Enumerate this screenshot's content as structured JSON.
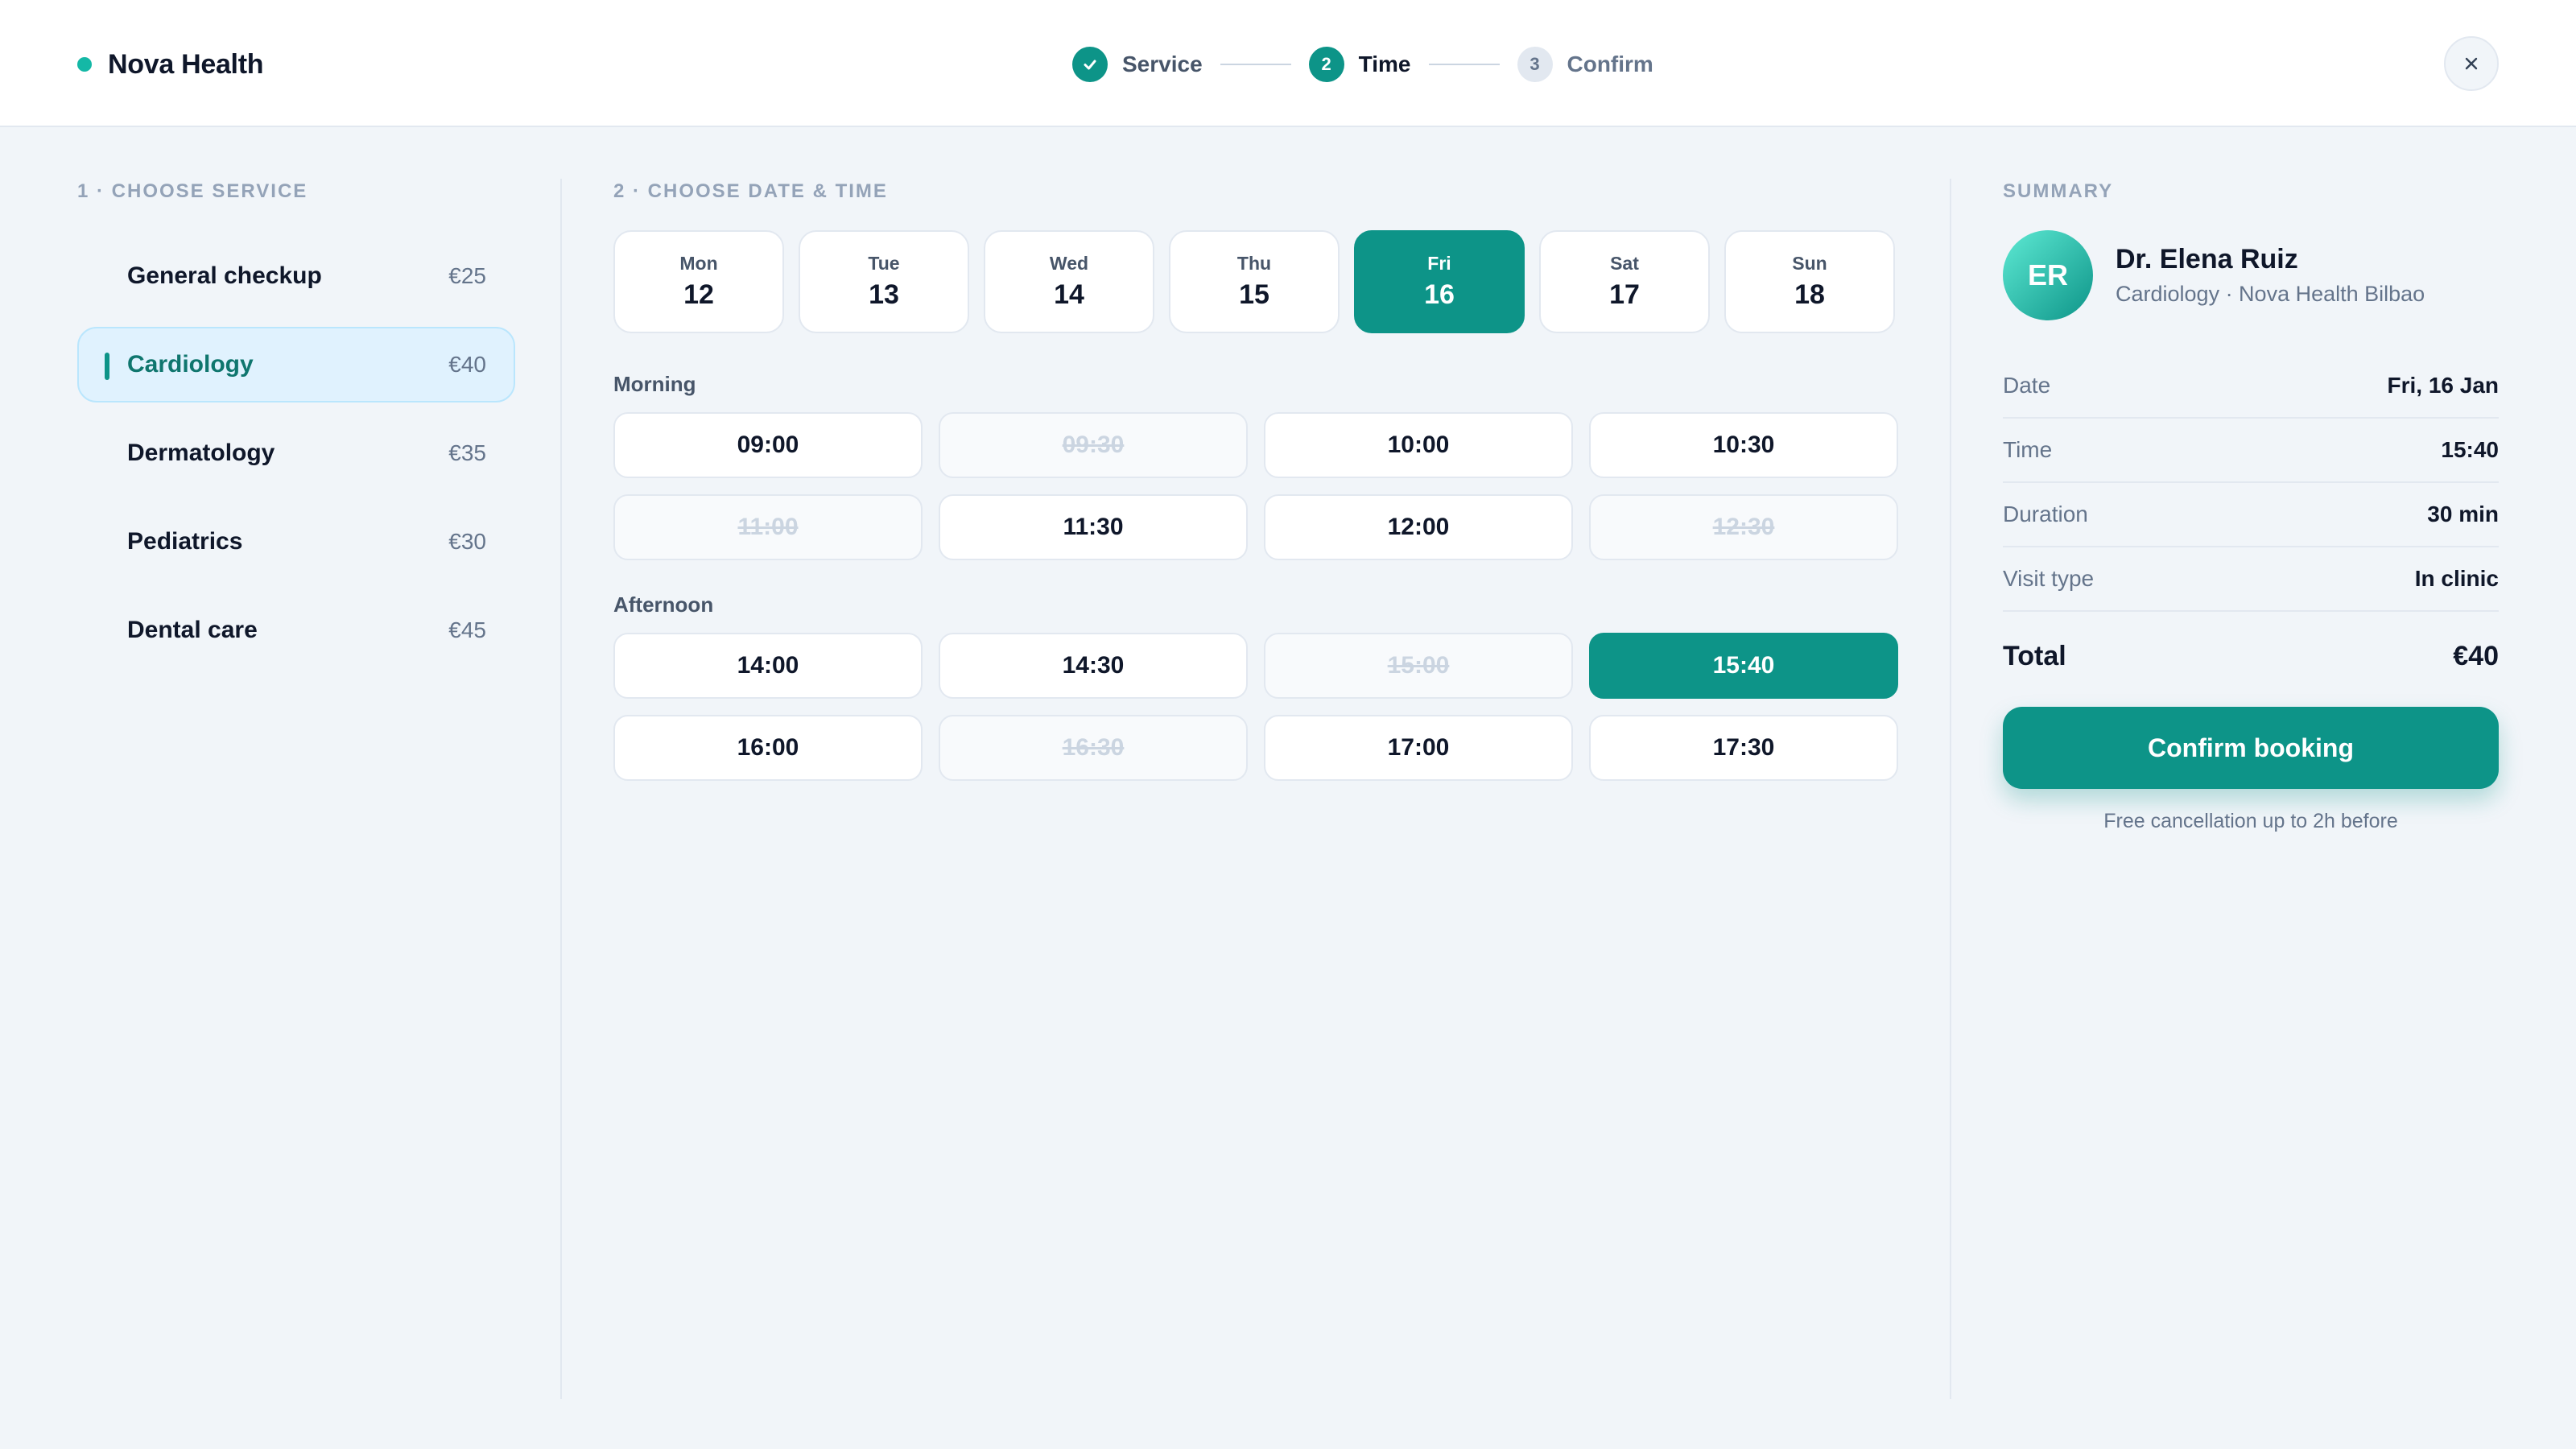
{
  "brand": {
    "name": "Nova Health",
    "accent": "#14b8a6"
  },
  "stepper": {
    "steps": [
      {
        "marker": "",
        "label": "Service",
        "state": "done"
      },
      {
        "marker": "2",
        "label": "Time",
        "state": "active"
      },
      {
        "marker": "3",
        "label": "Confirm",
        "state": "todo"
      }
    ]
  },
  "services": {
    "title": "1 · CHOOSE SERVICE",
    "items": [
      {
        "name": "General checkup",
        "price": "€25",
        "selected": false
      },
      {
        "name": "Cardiology",
        "price": "€40",
        "selected": true
      },
      {
        "name": "Dermatology",
        "price": "€35",
        "selected": false
      },
      {
        "name": "Pediatrics",
        "price": "€30",
        "selected": false
      },
      {
        "name": "Dental care",
        "price": "€45",
        "selected": false
      }
    ]
  },
  "datetime": {
    "title": "2 · CHOOSE DATE & TIME",
    "days": [
      {
        "day": "Mon",
        "num": "12",
        "selected": false
      },
      {
        "day": "Tue",
        "num": "13",
        "selected": false
      },
      {
        "day": "Wed",
        "num": "14",
        "selected": false
      },
      {
        "day": "Thu",
        "num": "15",
        "selected": false
      },
      {
        "day": "Fri",
        "num": "16",
        "selected": true
      },
      {
        "day": "Sat",
        "num": "17",
        "selected": false
      },
      {
        "day": "Sun",
        "num": "18",
        "selected": false
      }
    ],
    "morning_label": "Morning",
    "morning": [
      {
        "time": "09:00",
        "state": "available"
      },
      {
        "time": "09:30",
        "state": "disabled"
      },
      {
        "time": "10:00",
        "state": "available"
      },
      {
        "time": "10:30",
        "state": "available"
      },
      {
        "time": "11:00",
        "state": "disabled"
      },
      {
        "time": "11:30",
        "state": "available"
      },
      {
        "time": "12:00",
        "state": "available"
      },
      {
        "time": "12:30",
        "state": "disabled"
      }
    ],
    "afternoon_label": "Afternoon",
    "afternoon": [
      {
        "time": "14:00",
        "state": "available"
      },
      {
        "time": "14:30",
        "state": "available"
      },
      {
        "time": "15:00",
        "state": "disabled"
      },
      {
        "time": "15:40",
        "state": "selected"
      },
      {
        "time": "16:00",
        "state": "available"
      },
      {
        "time": "16:30",
        "state": "disabled"
      },
      {
        "time": "17:00",
        "state": "available"
      },
      {
        "time": "17:30",
        "state": "available"
      }
    ]
  },
  "summary": {
    "title": "SUMMARY",
    "doctor": {
      "initials": "ER",
      "name": "Dr. Elena Ruiz",
      "subtitle": "Cardiology · Nova Health Bilbao"
    },
    "rows": [
      {
        "key": "Date",
        "value": "Fri, 16 Jan"
      },
      {
        "key": "Time",
        "value": "15:40"
      },
      {
        "key": "Duration",
        "value": "30 min"
      },
      {
        "key": "Visit type",
        "value": "In clinic"
      }
    ],
    "total_label": "Total",
    "total_value": "€40",
    "confirm_label": "Confirm booking",
    "cancel_note": "Free cancellation up to 2h before"
  },
  "colors": {
    "primary": "#0d9488",
    "selected_service_bg": "#e0f2fe",
    "page_bg": "#f1f5f9"
  }
}
